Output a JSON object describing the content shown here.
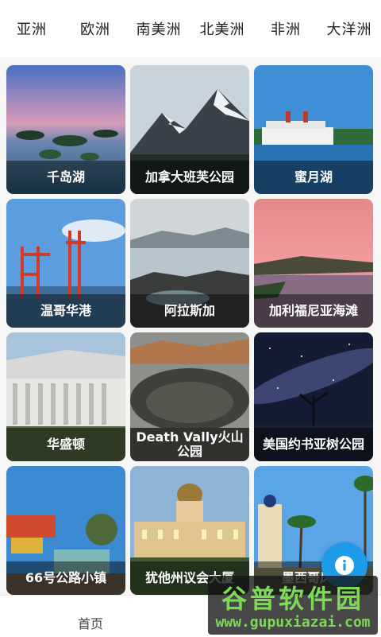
{
  "tabs": [
    "亚洲",
    "欧洲",
    "南美洲",
    "北美洲",
    "非洲",
    "大洋洲"
  ],
  "cards": [
    {
      "title": "千岛湖"
    },
    {
      "title": "加拿大班芙公园"
    },
    {
      "title": "蜜月湖"
    },
    {
      "title": "温哥华港"
    },
    {
      "title": "阿拉斯加"
    },
    {
      "title": "加利福尼亚海滩"
    },
    {
      "title": "华盛顿"
    },
    {
      "title": "Death Vally火山公园"
    },
    {
      "title": "美国约书亚树公园"
    },
    {
      "title": "66号公路小镇"
    },
    {
      "title": "犹他州议会大厦"
    },
    {
      "title": "墨西哥风情"
    }
  ],
  "bottom_nav": {
    "home_label": "首页"
  },
  "fab": {
    "icon": "info-icon",
    "color": "#1e9be8"
  },
  "watermark": {
    "title": "谷普软件园",
    "url": "www.gupuxiazai.com"
  }
}
